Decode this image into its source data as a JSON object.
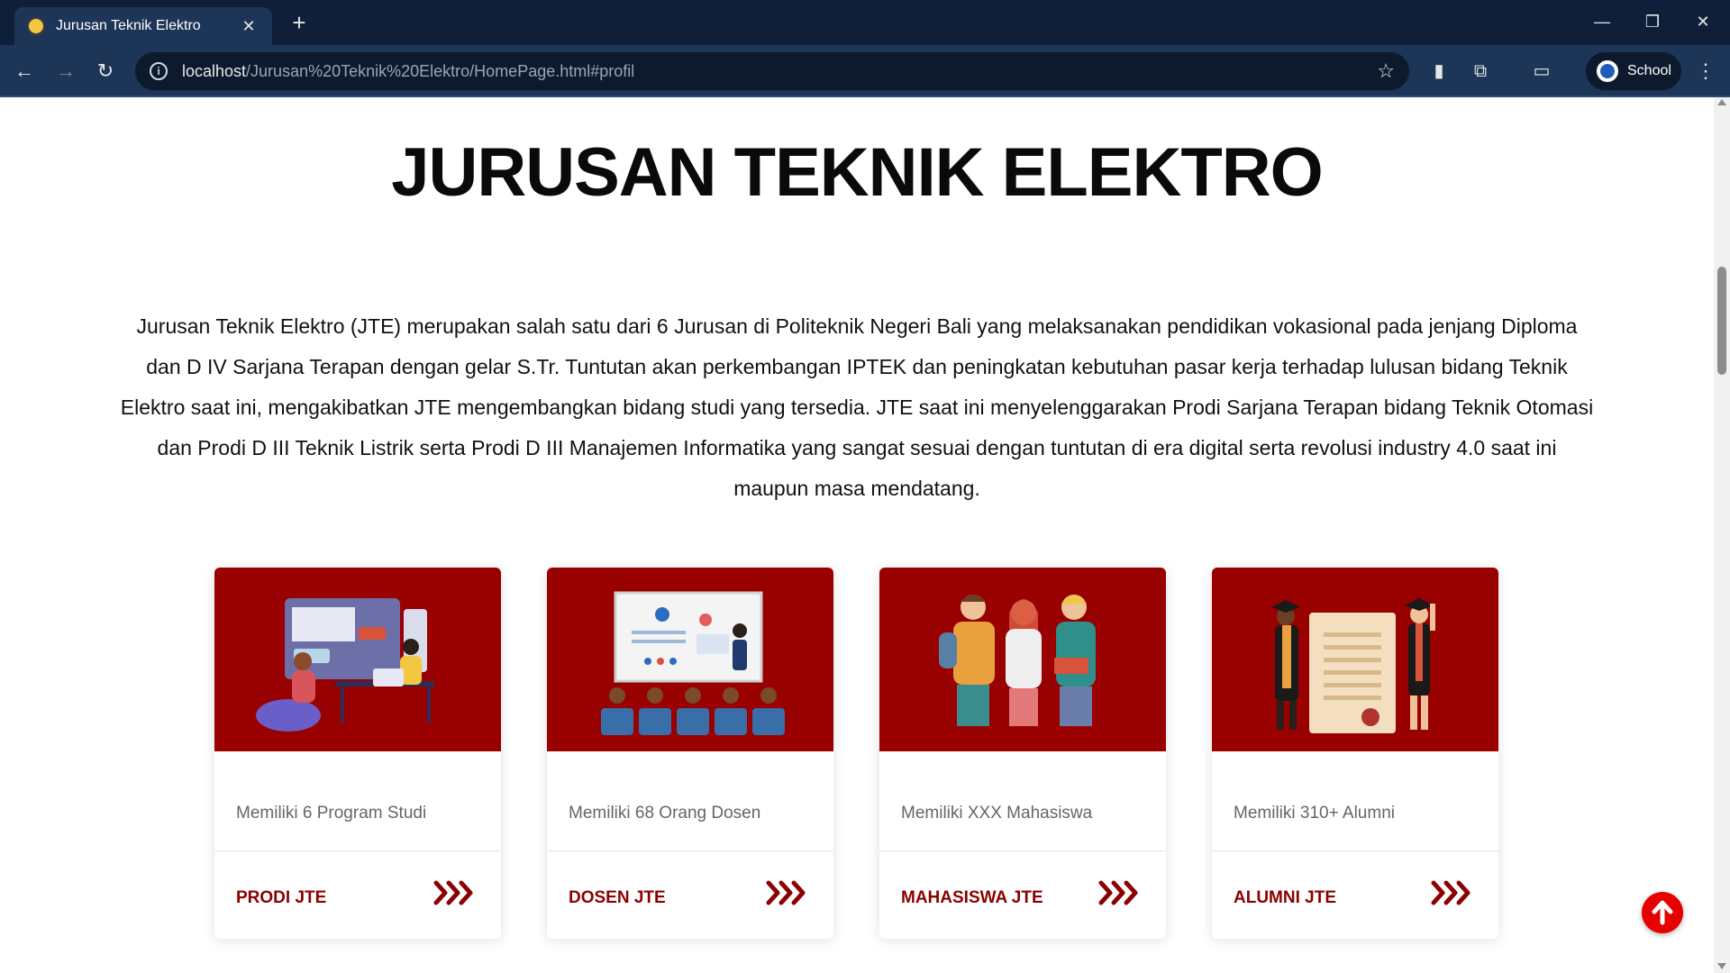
{
  "browser": {
    "tab_title": "Jurusan Teknik Elektro",
    "url_host": "localhost",
    "url_path": "/Jurusan%20Teknik%20Elektro/HomePage.html#profil",
    "profile_name": "School"
  },
  "page": {
    "title": "JURUSAN TEKNIK ELEKTRO",
    "intro": "Jurusan Teknik Elektro (JTE) merupakan salah satu dari 6 Jurusan di Politeknik Negeri Bali yang melaksanakan pendidikan vokasional pada jenjang Diploma dan D IV Sarjana Terapan dengan gelar S.Tr. Tuntutan akan perkembangan IPTEK dan peningkatan kebutuhan pasar kerja terhadap lulusan bidang Teknik Elektro saat ini, mengakibatkan JTE mengembangkan bidang studi yang tersedia. JTE saat ini menyelenggarakan Prodi Sarjana Terapan bidang Teknik Otomasi dan Prodi D III Teknik Listrik serta Prodi D III Manajemen Informatika yang sangat sesuai dengan tuntutan di era digital serta revolusi industry 4.0 saat ini maupun masa mendatang."
  },
  "cards": [
    {
      "text": "Memiliki 6 Program Studi",
      "link": "PRODI JTE",
      "illustration": "students-coding-illustration"
    },
    {
      "text": "Memiliki 68 Orang Dosen",
      "link": "DOSEN JTE",
      "illustration": "lecture-presentation-illustration"
    },
    {
      "text": "Memiliki XXX Mahasiswa",
      "link": "MAHASISWA JTE",
      "illustration": "three-students-illustration"
    },
    {
      "text": "Memiliki 310+ Alumni",
      "link": "ALUMNI JTE",
      "illustration": "graduation-diploma-illustration"
    }
  ],
  "colors": {
    "card_image_bg": "#990000",
    "link_text": "#8b0000",
    "scroll_top_button": "#e60000"
  }
}
